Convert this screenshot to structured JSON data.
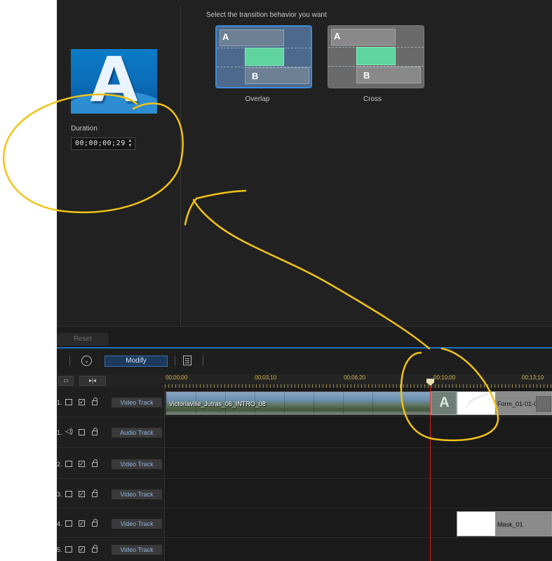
{
  "transition_panel": {
    "duration_label": "Duration",
    "duration_value": "00;00;00;29",
    "spin_up": "▲",
    "spin_down": "▼",
    "thumbnail_letter": "A",
    "behavior_title": "Select the transition behavior you want",
    "options": [
      {
        "caption": "Overlap",
        "letter_a": "A",
        "letter_b": "B",
        "selected": true
      },
      {
        "caption": "Cross",
        "letter_a": "A",
        "letter_b": "B",
        "selected": false
      }
    ],
    "reset_label": "Reset"
  },
  "toolbar": {
    "modify_label": "Modify",
    "expand_icon": "⌄"
  },
  "ruler": {
    "labels": [
      "00;00;00",
      "00;03;10",
      "00;06;20",
      "00;10;00",
      "00;13;10"
    ],
    "fit_button": "▭",
    "split_button": "▸|◂"
  },
  "tracks": [
    {
      "num": "1.",
      "name": "Video Track",
      "type": "video",
      "checked": true
    },
    {
      "num": "1.",
      "name": "Audio Track",
      "type": "audio",
      "checked": false
    },
    {
      "num": "2.",
      "name": "Video Track",
      "type": "video",
      "checked": true
    },
    {
      "num": "3.",
      "name": "Video Track",
      "type": "video",
      "checked": true
    },
    {
      "num": "4.",
      "name": "Video Track",
      "type": "video",
      "checked": true
    },
    {
      "num": "5.",
      "name": "Video Track",
      "type": "video",
      "checked": true
    }
  ],
  "clips": {
    "main_video": "Victoriaville_Jutras_06_INTRO_08",
    "transition_letter": "A",
    "form": "Form_01-01-0",
    "mask": "Mask_01"
  },
  "colors": {
    "accent": "#3d8de0",
    "annotation": "#f2c318",
    "playhead": "#e0201c",
    "transition_green": "#5fd49e"
  }
}
